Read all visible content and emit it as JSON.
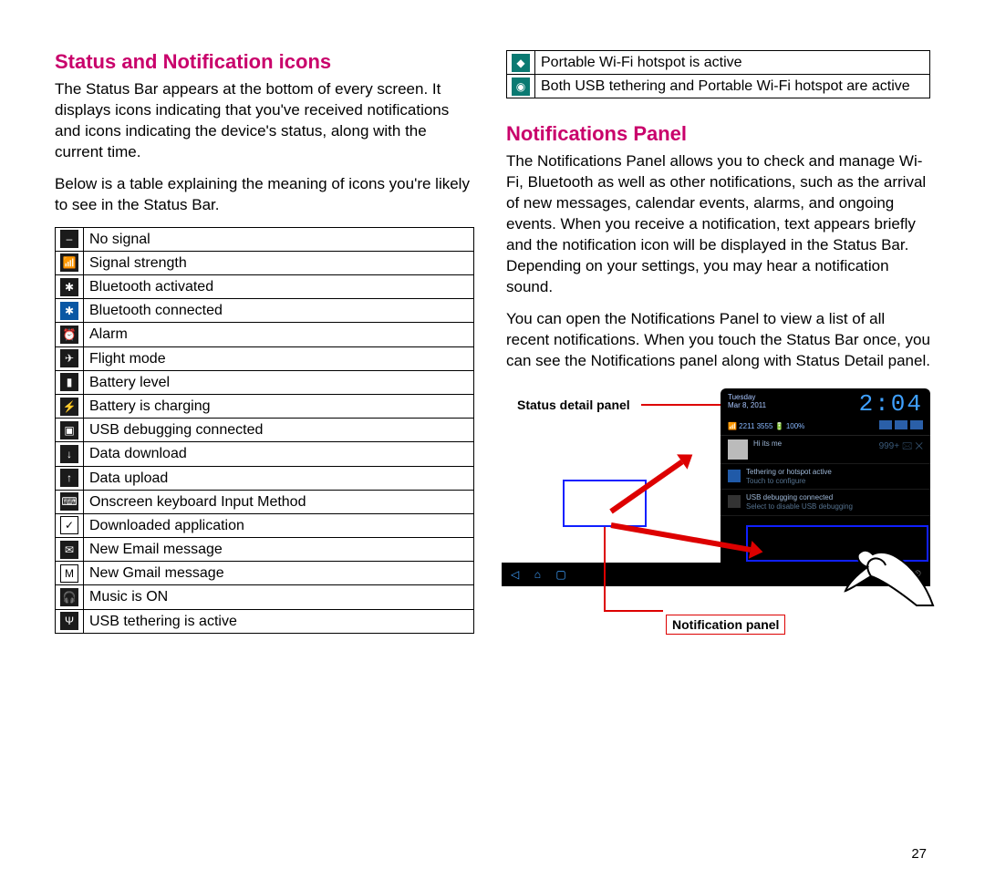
{
  "page_number": "27",
  "left": {
    "heading": "Status and Notification icons",
    "para1": "The Status Bar appears at the bottom of every screen. It displays icons indicating that you've received notifications and icons indicating the device's status, along with the current time.",
    "para2": "Below is a table explaining the meaning of icons you're likely to see in the Status Bar.",
    "icons": [
      {
        "glyph": "–",
        "class": "",
        "name": "no-signal-icon",
        "label": "No signal"
      },
      {
        "glyph": "📶",
        "class": "",
        "name": "signal-strength-icon",
        "label": "Signal strength"
      },
      {
        "glyph": "✱",
        "class": "",
        "name": "bluetooth-activated-icon",
        "label": "Bluetooth activated"
      },
      {
        "glyph": "✱",
        "class": "blue",
        "name": "bluetooth-connected-icon",
        "label": "Bluetooth connected"
      },
      {
        "glyph": "⏰",
        "class": "",
        "name": "alarm-icon",
        "label": "Alarm"
      },
      {
        "glyph": "✈",
        "class": "",
        "name": "flight-mode-icon",
        "label": "Flight mode"
      },
      {
        "glyph": "▮",
        "class": "",
        "name": "battery-level-icon",
        "label": "Battery level"
      },
      {
        "glyph": "⚡",
        "class": "",
        "name": "battery-charging-icon",
        "label": "Battery is charging"
      },
      {
        "glyph": "▣",
        "class": "",
        "name": "usb-debugging-icon",
        "label": "USB debugging connected"
      },
      {
        "glyph": "↓",
        "class": "",
        "name": "data-download-icon",
        "label": "Data download"
      },
      {
        "glyph": "↑",
        "class": "",
        "name": "data-upload-icon",
        "label": "Data upload"
      },
      {
        "glyph": "⌨",
        "class": "",
        "name": "keyboard-input-icon",
        "label": "Onscreen keyboard Input Method"
      },
      {
        "glyph": "✓",
        "class": "light",
        "name": "downloaded-app-icon",
        "label": "Downloaded application"
      },
      {
        "glyph": "✉",
        "class": "",
        "name": "new-email-icon",
        "label": "New Email message"
      },
      {
        "glyph": "M",
        "class": "light",
        "name": "new-gmail-icon",
        "label": "New Gmail message"
      },
      {
        "glyph": "🎧",
        "class": "",
        "name": "music-on-icon",
        "label": "Music is ON"
      },
      {
        "glyph": "Ψ",
        "class": "",
        "name": "usb-tethering-icon",
        "label": "USB tethering is active"
      }
    ]
  },
  "right": {
    "top_icons": [
      {
        "glyph": "◆",
        "class": "teal",
        "name": "portable-hotspot-icon",
        "label": "Portable Wi-Fi hotspot is active"
      },
      {
        "glyph": "◉",
        "class": "teal",
        "name": "usb-and-hotspot-icon",
        "label": "Both USB tethering and Portable Wi-Fi hotspot are active"
      }
    ],
    "heading": "Notifications Panel",
    "para1": "The Notifications Panel allows you to check and manage Wi-Fi, Bluetooth as well as other notifications, such as the arrival of new messages, calendar events, alarms, and ongoing events. When you receive a notification, text appears briefly and the notification icon will be displayed in the Status Bar. Depending on your settings, you may hear a notification sound.",
    "para2": "You can open the Notifications Panel to view a list of all recent notifications. When you touch the Status Bar once, you can see the Notifications panel along with  Status Detail panel.",
    "callouts": {
      "status_detail": "Status detail panel",
      "notification_panel": "Notification panel"
    },
    "device": {
      "day": "Tuesday",
      "date": "Mar 8, 2011",
      "clock": "2:04",
      "signal_text": "📶 2211 3555   🔋 100%",
      "notif1_title": "Hi its me",
      "notif1_badge": "999+",
      "notif1_sym": "🖂  ✕",
      "notif2_title": "Tethering or hotspot active",
      "notif2_sub": "Touch to configure",
      "notif3_title": "USB debugging connected",
      "notif3_sub": "Select to disable USB debugging"
    }
  }
}
